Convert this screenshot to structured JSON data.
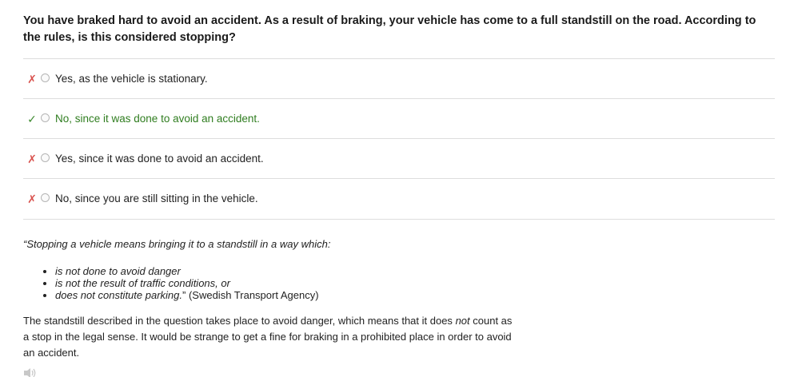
{
  "question": {
    "text": "You have braked hard to avoid an accident. As a result of braking, your vehicle has come to a full standstill on the road. According to the rules, is this considered stopping?"
  },
  "options": [
    {
      "label": "Yes, as the vehicle is stationary.",
      "mark": "✗",
      "status": "wrong"
    },
    {
      "label": "No, since it was done to avoid an accident.",
      "mark": "✓",
      "status": "correct"
    },
    {
      "label": "Yes, since it was done to avoid an accident.",
      "mark": "✗",
      "status": "wrong"
    },
    {
      "label": "No, since you are still sitting in the vehicle.",
      "mark": "✗",
      "status": "wrong"
    }
  ],
  "explanation": {
    "quote_intro": "“Stopping a vehicle means bringing it to a standstill in a way which:",
    "rules": [
      "is not done to avoid danger",
      "is not the result of traffic conditions, or",
      "does not constitute parking."
    ],
    "source": " (Swedish Transport Agency)",
    "summary_before": "The standstill described in the question takes place to avoid danger, which means that it does ",
    "summary_emph": "not",
    "summary_after": " count as a stop in the legal sense. It would be strange to get a fine for braking in a prohibited place in order to avoid an accident."
  },
  "audio": {
    "icon": "speaker-icon"
  },
  "colors": {
    "wrong": "#d9534f",
    "correct": "#2f7d1f",
    "divider": "#dddddd"
  }
}
